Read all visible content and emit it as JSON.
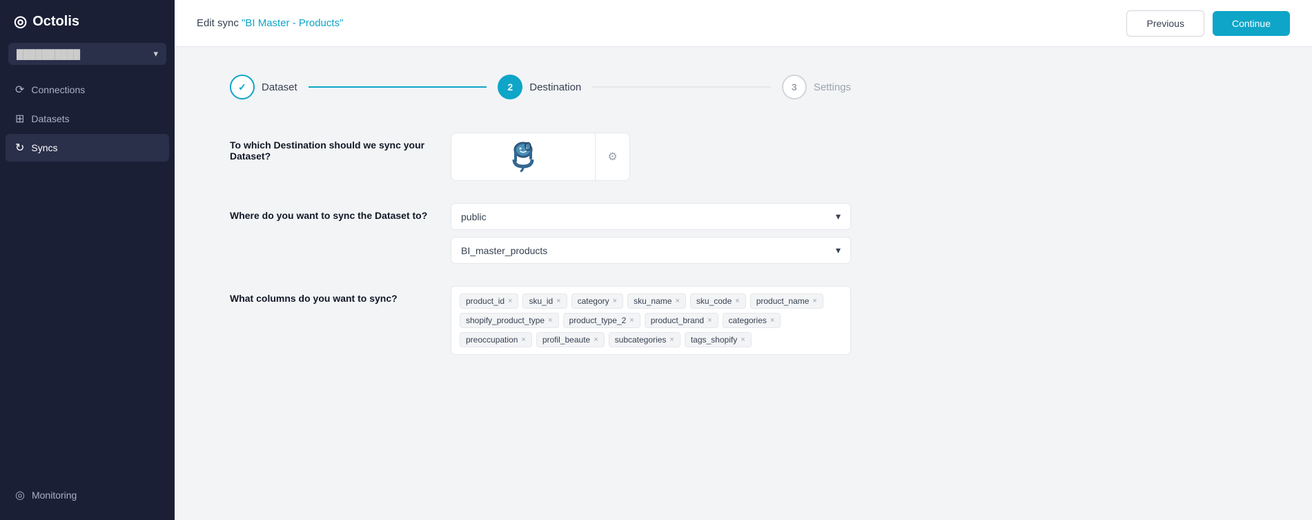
{
  "sidebar": {
    "logo": "Octolis",
    "logo_icon": "◎",
    "workspace": {
      "name": "██████████",
      "chevron": "▾"
    },
    "nav_items": [
      {
        "id": "connections",
        "label": "Connections",
        "icon": "⟳"
      },
      {
        "id": "datasets",
        "label": "Datasets",
        "icon": "⊞"
      },
      {
        "id": "syncs",
        "label": "Syncs",
        "icon": "↻",
        "active": true
      }
    ],
    "bottom_items": [
      {
        "id": "monitoring",
        "label": "Monitoring",
        "icon": "◎"
      }
    ]
  },
  "header": {
    "title_prefix": "Edit sync ",
    "sync_name": "\"BI Master - Products\"",
    "btn_previous": "Previous",
    "btn_continue": "Continue"
  },
  "stepper": {
    "steps": [
      {
        "id": "dataset",
        "label": "Dataset",
        "state": "done",
        "number": "✓"
      },
      {
        "id": "destination",
        "label": "Destination",
        "state": "active",
        "number": "2"
      },
      {
        "id": "settings",
        "label": "Settings",
        "state": "inactive",
        "number": "3"
      }
    ]
  },
  "form": {
    "destination_question": "To which Destination should we sync your Dataset?",
    "schema_question": "Where do you want to sync the Dataset to?",
    "columns_question": "What columns do you want to sync?",
    "schema_value": "public",
    "table_value": "BI_master_products",
    "columns": [
      "product_id",
      "sku_id",
      "category",
      "sku_name",
      "sku_code",
      "product_name",
      "shopify_product_type",
      "product_type_2",
      "product_brand",
      "categories",
      "preoccupation",
      "profil_beaute",
      "subcategories",
      "tags_shopify"
    ],
    "settings_icon": "⚙"
  },
  "colors": {
    "accent": "#0ea5c8",
    "sidebar_bg": "#1a1f36",
    "border": "#e5e7eb"
  }
}
